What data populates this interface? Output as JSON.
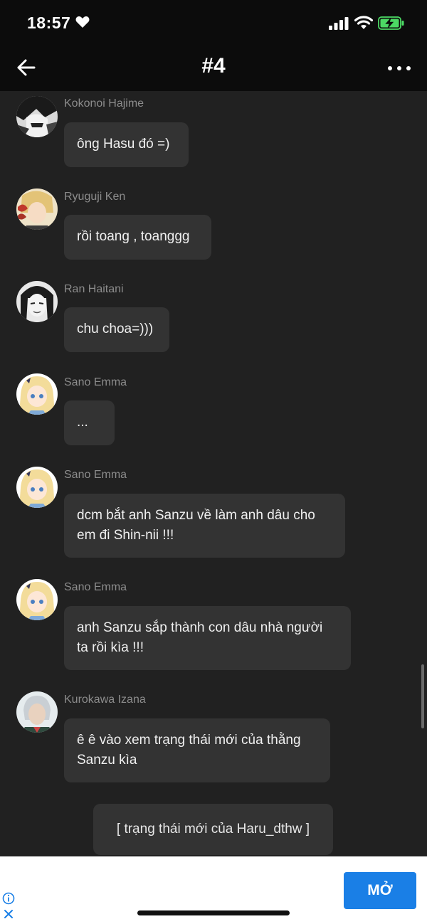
{
  "status_bar": {
    "time": "18:57"
  },
  "header": {
    "title": "#4"
  },
  "messages": [
    {
      "sender": "Kokonoi Hajime",
      "text": "ông Hasu đó =)"
    },
    {
      "sender": "Ryuguji Ken",
      "text": "rồi toang , toanggg"
    },
    {
      "sender": "Ran Haitani",
      "text": "chu choa=)))"
    },
    {
      "sender": "Sano Emma",
      "text": "..."
    },
    {
      "sender": "Sano Emma",
      "text": "dcm bắt anh Sanzu về làm anh dâu cho\nem đi Shin-nii !!!"
    },
    {
      "sender": "Sano Emma",
      "text": "anh Sanzu sắp thành con dâu nhà người\nta rồi kìa !!!"
    },
    {
      "sender": "Kurokawa Izana",
      "text": "ê ê vào xem trạng thái mới của thằng\nSanzu kìa"
    }
  ],
  "system_message": "[ trạng thái mới của Haru_dthw ]",
  "ad": {
    "open_label": "MỞ"
  },
  "colors": {
    "background": "#212121",
    "header": "#0c0c0c",
    "bubble": "#333333",
    "ad_button": "#1a7fe6",
    "battery_green": "#4cd964"
  }
}
